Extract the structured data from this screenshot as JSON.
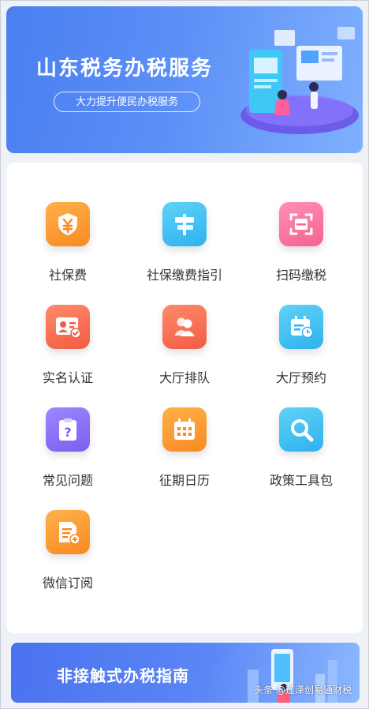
{
  "banner": {
    "title": "山东税务办税服务",
    "subtitle": "大力提升便民办税服务"
  },
  "services": [
    {
      "label": "社保费",
      "icon": "shield-yuan-icon",
      "color": "#f98a22"
    },
    {
      "label": "社保缴费指引",
      "icon": "signpost-icon",
      "color": "#2fb2ef"
    },
    {
      "label": "扫码缴税",
      "icon": "scan-icon",
      "color": "#f5638f"
    },
    {
      "label": "实名认证",
      "icon": "id-card-check-icon",
      "color": "#f25c44"
    },
    {
      "label": "大厅排队",
      "icon": "people-queue-icon",
      "color": "#f25c44"
    },
    {
      "label": "大厅预约",
      "icon": "calendar-clock-icon",
      "color": "#2fb2ef"
    },
    {
      "label": "常见问题",
      "icon": "question-clipboard-icon",
      "color": "#7b5ff0"
    },
    {
      "label": "征期日历",
      "icon": "calendar-icon",
      "color": "#f98a22"
    },
    {
      "label": "政策工具包",
      "icon": "magnifier-icon",
      "color": "#2fb2ef"
    },
    {
      "label": "微信订阅",
      "icon": "document-add-icon",
      "color": "#f98a22"
    }
  ],
  "bottom_banner": {
    "title": "非接触式办税指南"
  },
  "watermark": "头条 @莲泽创易通财税"
}
